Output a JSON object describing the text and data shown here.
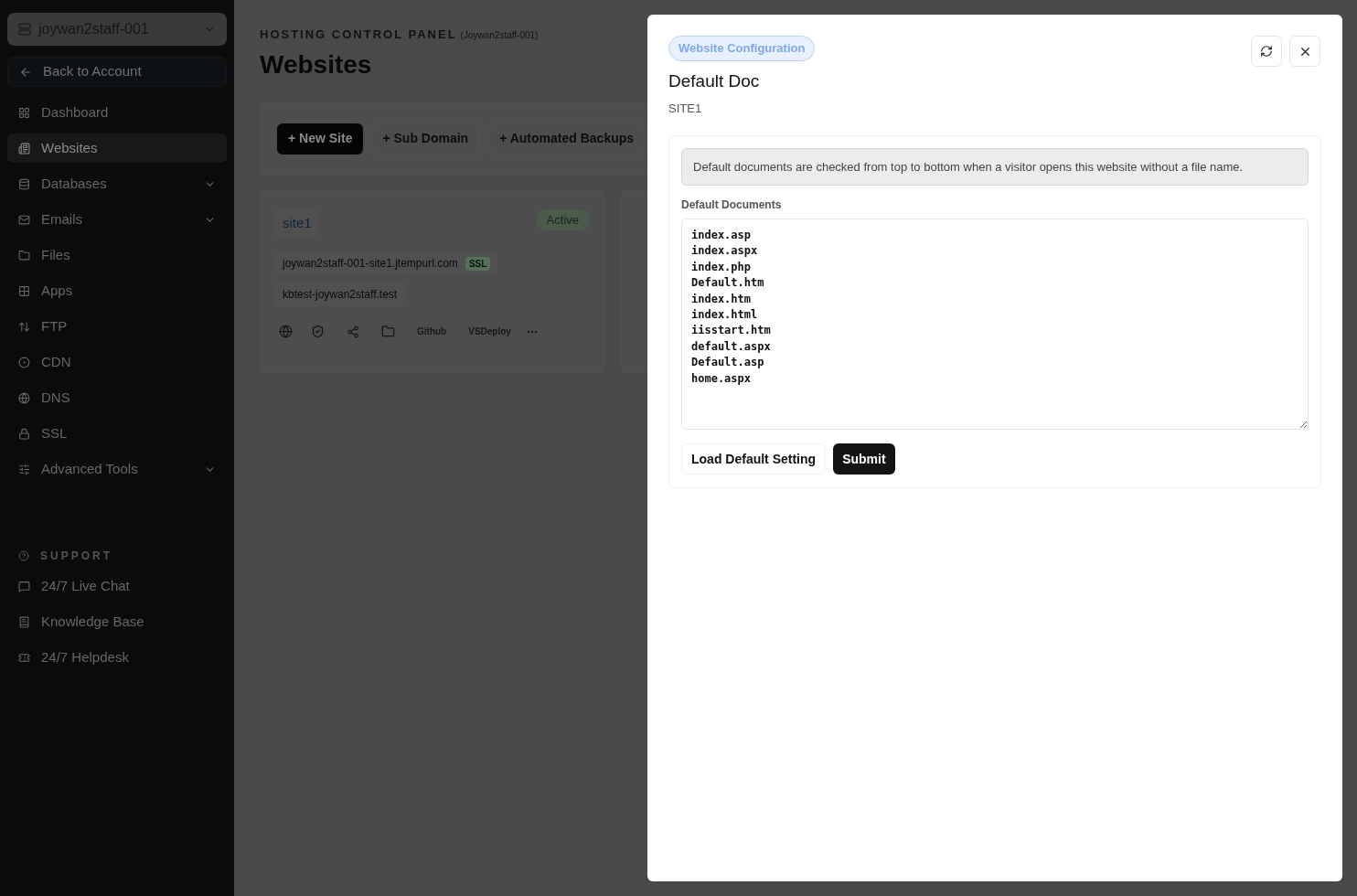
{
  "sidebar": {
    "account": "joywan2staff-001",
    "back": "Back to Account",
    "items": [
      {
        "label": "Dashboard",
        "selected": false,
        "expandable": false
      },
      {
        "label": "Websites",
        "selected": true,
        "expandable": false
      },
      {
        "label": "Databases",
        "selected": false,
        "expandable": true
      },
      {
        "label": "Emails",
        "selected": false,
        "expandable": true
      },
      {
        "label": "Files",
        "selected": false,
        "expandable": false
      },
      {
        "label": "Apps",
        "selected": false,
        "expandable": false
      },
      {
        "label": "FTP",
        "selected": false,
        "expandable": false
      },
      {
        "label": "CDN",
        "selected": false,
        "expandable": false
      },
      {
        "label": "DNS",
        "selected": false,
        "expandable": false
      },
      {
        "label": "SSL",
        "selected": false,
        "expandable": false
      },
      {
        "label": "Advanced Tools",
        "selected": false,
        "expandable": true
      }
    ],
    "support_heading": "SUPPORT",
    "support_items": [
      "24/7 Live Chat",
      "Knowledge Base",
      "24/7 Helpdesk"
    ]
  },
  "header": {
    "eyebrow": "HOSTING CONTROL PANEL",
    "account": "(Joywan2staff-001)",
    "title": "Websites"
  },
  "toolbar": [
    "+ New Site",
    "+ Sub Domain",
    "+ Automated Backups"
  ],
  "site_card": {
    "name": "site1",
    "status": "Active",
    "domains": [
      {
        "text": "joywan2staff-001-site1.jtempurl.com",
        "badge": "SSL"
      },
      {
        "text": "kbtest-joywan2staff.test"
      }
    ],
    "actions": [
      "Github",
      "VSDeploy"
    ]
  },
  "modal": {
    "tag": "Website Configuration",
    "title": "Default Doc",
    "subtitle": "SITE1",
    "info": "Default documents are checked from top to bottom when a visitor opens this website without a file name.",
    "field_label": "Default Documents",
    "documents": [
      "index.asp",
      "index.aspx",
      "index.php",
      "Default.htm",
      "index.htm",
      "index.html",
      "iisstart.htm",
      "default.aspx",
      "Default.asp",
      "home.aspx"
    ],
    "buttons": [
      "Load Default Setting",
      "Submit"
    ]
  }
}
